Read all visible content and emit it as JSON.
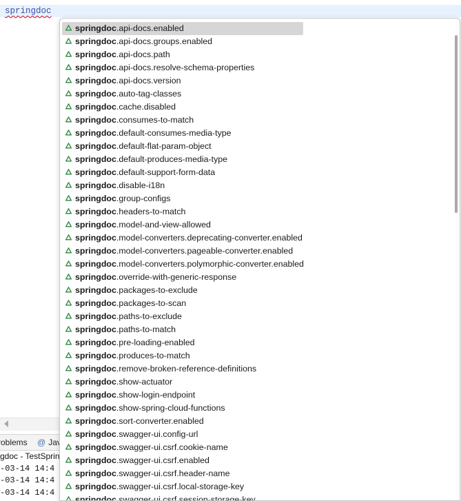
{
  "editor": {
    "text": "springdoc"
  },
  "panel": {
    "tabs": [
      {
        "label": "roblems"
      },
      {
        "label": "Jav"
      }
    ],
    "console_title": "gdoc - TestSpring",
    "console_lines": [
      "-03-14 14:4",
      "-03-14 14:4",
      "-03-14 14:4"
    ]
  },
  "popup": {
    "prefix": "springdoc",
    "selected_index": 0,
    "icon": "green-triangle-property-icon",
    "icon_color": "#3d8f4b",
    "items": [
      ".api-docs.enabled",
      ".api-docs.groups.enabled",
      ".api-docs.path",
      ".api-docs.resolve-schema-properties",
      ".api-docs.version",
      ".auto-tag-classes",
      ".cache.disabled",
      ".consumes-to-match",
      ".default-consumes-media-type",
      ".default-flat-param-object",
      ".default-produces-media-type",
      ".default-support-form-data",
      ".disable-i18n",
      ".group-configs",
      ".headers-to-match",
      ".model-and-view-allowed",
      ".model-converters.deprecating-converter.enabled",
      ".model-converters.pageable-converter.enabled",
      ".model-converters.polymorphic-converter.enabled",
      ".override-with-generic-response",
      ".packages-to-exclude",
      ".packages-to-scan",
      ".paths-to-exclude",
      ".paths-to-match",
      ".pre-loading-enabled",
      ".produces-to-match",
      ".remove-broken-reference-definitions",
      ".show-actuator",
      ".show-login-endpoint",
      ".show-spring-cloud-functions",
      ".sort-converter.enabled",
      ".swagger-ui.config-url",
      ".swagger-ui.csrf.cookie-name",
      ".swagger-ui.csrf.enabled",
      ".swagger-ui.csrf.header-name",
      ".swagger-ui.csrf.local-storage-key",
      ".swagger-ui.csrf.session-storage-key"
    ]
  }
}
